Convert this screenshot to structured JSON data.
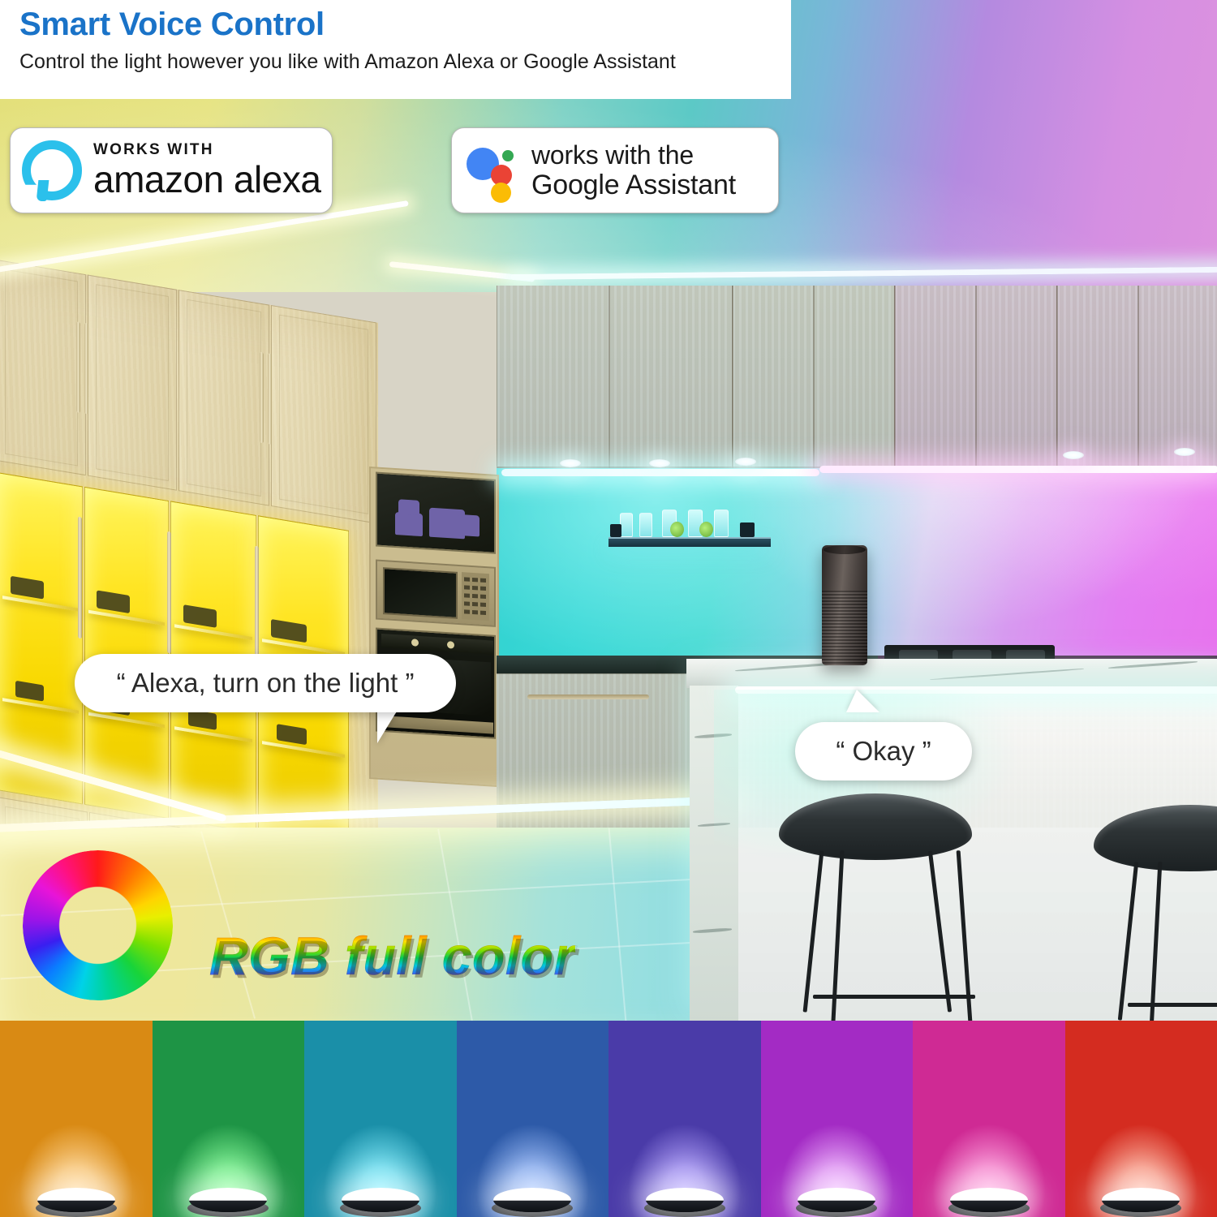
{
  "header": {
    "title": "Smart Voice Control",
    "subtitle": "Control the light however you like with Amazon Alexa or Google Assistant"
  },
  "badges": {
    "alexa": {
      "name": "works-with-amazon-alexa",
      "line1": "WORKS WITH",
      "line2": "amazon alexa",
      "logo_icon": "alexa-ring-icon",
      "logo_color": "#2bc0eb"
    },
    "google": {
      "name": "works-with-google-assistant",
      "line1": "works with the",
      "line2": "Google Assistant",
      "logo_icon": "google-assistant-dots-icon",
      "dot_colors": [
        "#4285f4",
        "#ea4335",
        "#34a853",
        "#fbbc05"
      ]
    }
  },
  "bubbles": {
    "user": "“ Alexa, turn on the light ”",
    "assistant": "“ Okay ”"
  },
  "feature": {
    "wheel_icon": "rgb-color-wheel-icon",
    "label": "RGB full color"
  },
  "scene": {
    "name": "kitchen-rgb-led-scene",
    "devices": [
      "amazon-echo-speaker",
      "bar-stool",
      "bar-stool",
      "microwave",
      "oven"
    ],
    "zones": [
      {
        "name": "glass-display-cabinets",
        "color": "#ffe524"
      },
      {
        "name": "backsplash-left",
        "color": "#39d8d6"
      },
      {
        "name": "backsplash-right",
        "color": "#e37ef2"
      },
      {
        "name": "toe-kick-floor",
        "color": "#efe79e"
      }
    ]
  },
  "swatches": [
    {
      "name": "orange",
      "wall": "#d98a14",
      "glow": "#ffd89a"
    },
    {
      "name": "green",
      "wall": "#1e9445",
      "glow": "#8dff9e"
    },
    {
      "name": "cyan",
      "wall": "#1a8fa8",
      "glow": "#8af0ff"
    },
    {
      "name": "blue",
      "wall": "#2d5aa8",
      "glow": "#a8c6ff"
    },
    {
      "name": "indigo",
      "wall": "#4a3ba8",
      "glow": "#b8a8ff"
    },
    {
      "name": "purple",
      "wall": "#a32bc4",
      "glow": "#f0b8ff"
    },
    {
      "name": "pink",
      "wall": "#cf2a94",
      "glow": "#ffa8e0"
    },
    {
      "name": "red",
      "wall": "#d42c20",
      "glow": "#ffbba8"
    }
  ]
}
